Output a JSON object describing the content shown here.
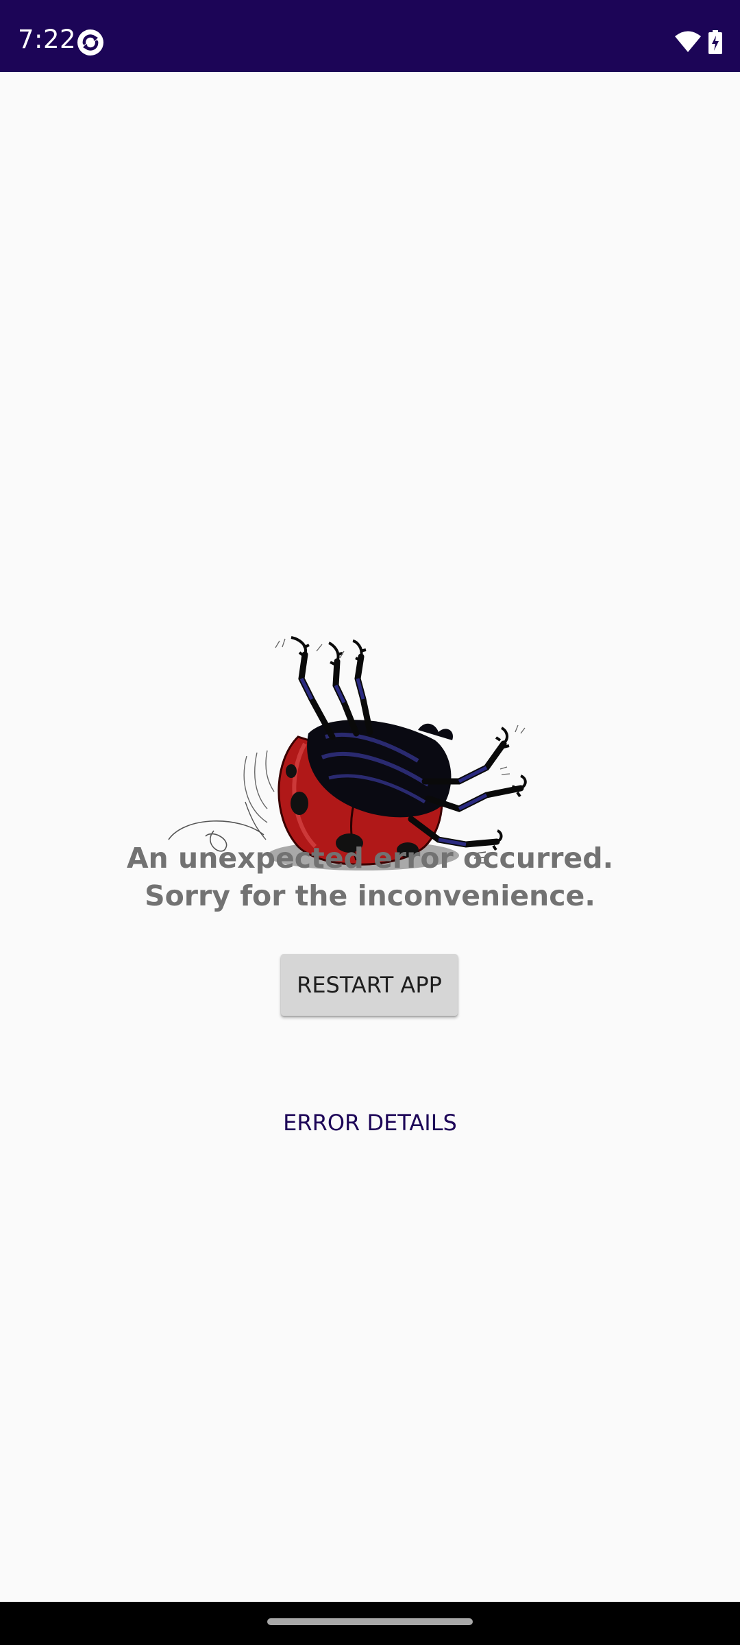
{
  "status_bar": {
    "time": "7:22",
    "app_icon": "app-sync-icon",
    "wifi_icon": "wifi-icon",
    "battery_icon": "battery-charging-icon",
    "background_color": "#1c0557"
  },
  "main": {
    "illustration": "upside-down-ladybug-illustration",
    "message_line1": "An unexpected error occurred.",
    "message_line2": "Sorry for the inconvenience.",
    "restart_label": "RESTART APP",
    "details_label": "ERROR DETAILS",
    "accent_color": "#1c0557",
    "message_color": "#727272"
  },
  "nav_bar": {
    "home_indicator": "home-gesture-handle"
  }
}
